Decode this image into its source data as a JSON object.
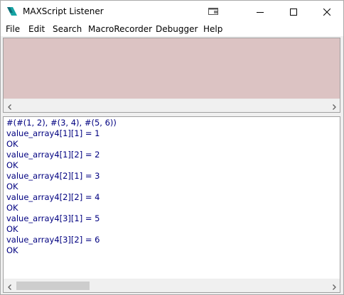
{
  "window": {
    "title": "MAXScript Listener"
  },
  "menu": [
    "File",
    "Edit",
    "Search",
    "MacroRecorder",
    "Debugger",
    "Help"
  ],
  "macro_pane": {
    "background": "#dcc3c3"
  },
  "output": {
    "lines": [
      "#(#(1, 2), #(3, 4), #(5, 6))",
      "value_array4[1][1] = 1",
      "OK",
      "value_array4[1][2] = 2",
      "OK",
      "value_array4[2][1] = 3",
      "OK",
      "value_array4[2][2] = 4",
      "OK",
      "value_array4[3][1] = 5",
      "OK",
      "value_array4[3][2] = 6",
      "OK"
    ],
    "text_color": "#000080"
  },
  "icons": {
    "app": "3dsmax-app-icon",
    "dock": "dock-window-icon",
    "minimize": "minimize-icon",
    "maximize": "maximize-icon",
    "close": "close-icon",
    "scroll_left": "chevron-left-icon",
    "scroll_right": "chevron-right-icon"
  }
}
